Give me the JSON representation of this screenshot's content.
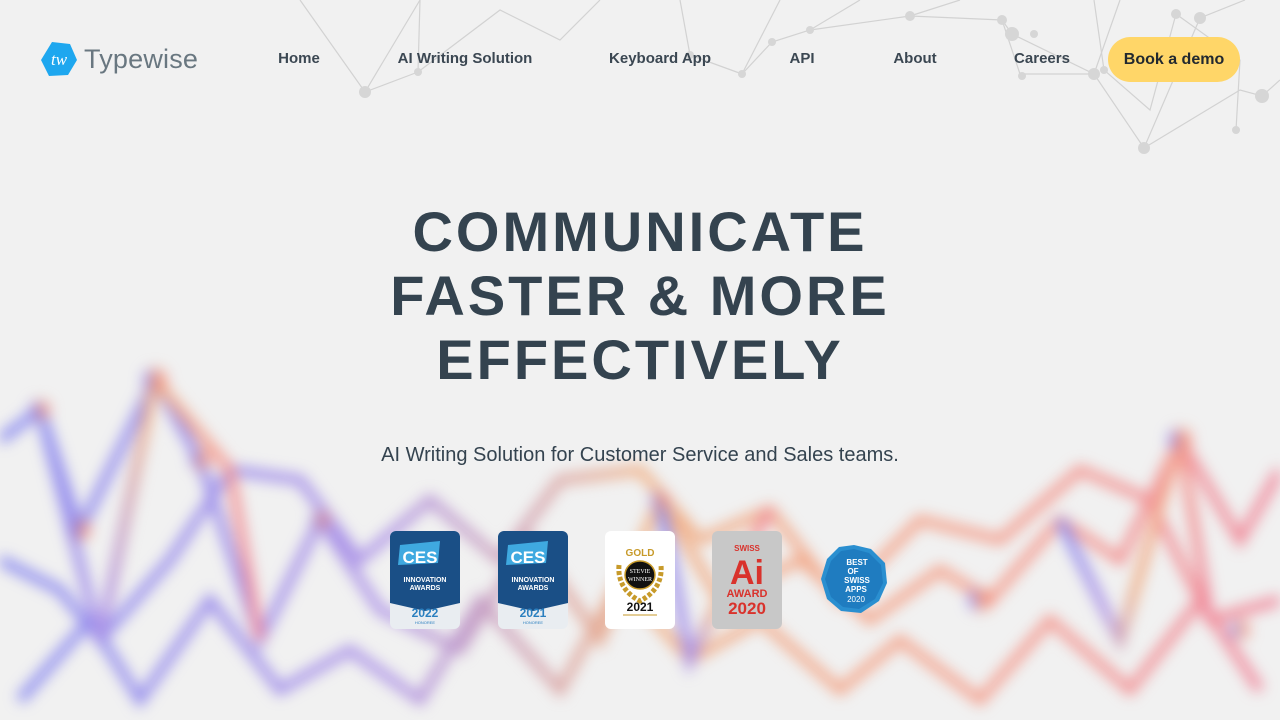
{
  "brand": {
    "name": "Typewise",
    "logo_initials": "tw"
  },
  "nav": {
    "items": [
      {
        "label": "Home"
      },
      {
        "label": "AI Writing Solution"
      },
      {
        "label": "Keyboard App"
      },
      {
        "label": "API"
      },
      {
        "label": "About"
      },
      {
        "label": "Careers"
      }
    ],
    "cta_label": "Book a demo"
  },
  "hero": {
    "title_lines": [
      "COMMUNICATE",
      "FASTER & MORE",
      "EFFECTIVELY"
    ],
    "subtitle": "AI Writing Solution for Customer Service and Sales teams."
  },
  "badges": [
    {
      "name": "ces-2022",
      "brand": "CES",
      "line1": "INNOVATION",
      "line2": "AWARDS",
      "year": "2022",
      "note": "HONOREE"
    },
    {
      "name": "ces-2021",
      "brand": "CES",
      "line1": "INNOVATION",
      "line2": "AWARDS",
      "year": "2021",
      "note": "HONOREE"
    },
    {
      "name": "stevie-gold-2021",
      "line1": "GOLD",
      "line2": "STEVIE",
      "line3": "WINNER",
      "year": "2021"
    },
    {
      "name": "swiss-ai-award-2020",
      "line1": "SWISS",
      "line2": "Ai",
      "line3": "AWARD",
      "year": "2020"
    },
    {
      "name": "best-of-swiss-apps-2020",
      "line1": "BEST",
      "line2": "OF",
      "line3": "SWISS",
      "line4": "APPS",
      "year": "2020"
    }
  ],
  "colors": {
    "background": "#f1f1f1",
    "text": "#34434f",
    "cta": "#ffd668",
    "logo_blue": "#1ea7ef"
  }
}
